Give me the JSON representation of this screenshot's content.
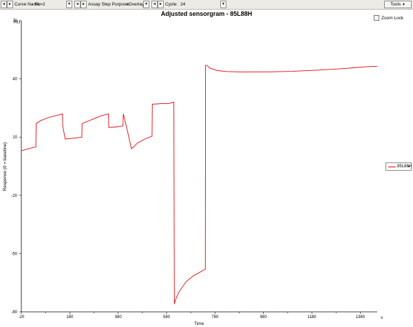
{
  "toolbar": {
    "curve_name_label": "Curve Name:",
    "curve_name_value": "Fc=2",
    "assay_step_label": "Assay Step Purpose:",
    "assay_step_value": "<Overlay>",
    "cycle_label": "Cycle:",
    "cycle_value": "24",
    "tools_label": "Tools"
  },
  "zoom_lock_label": "Zoom Lock",
  "legend_arrow": "▸",
  "colors": {
    "series": "#e0000b",
    "toolbar": "#ecebe6"
  },
  "chart_data": {
    "type": "line",
    "title": "Adjusted sensorgram - 85L88H",
    "xlabel": "Time",
    "ylabel": "Response (0 = baseline)",
    "y_unit": "RU",
    "x_unit": "s",
    "xlim": [
      -20,
      1450
    ],
    "ylim": [
      -80,
      70
    ],
    "x_ticks": [
      -20,
      180,
      380,
      580,
      780,
      980,
      1180,
      1380
    ],
    "y_ticks": [
      -80,
      -50,
      -20,
      10,
      40,
      70
    ],
    "legend_position": "right",
    "series": [
      {
        "name": "85L88H",
        "color": "#e0000b",
        "x": [
          -20,
          10,
          40,
          41,
          60,
          90,
          120,
          150,
          151,
          161,
          200,
          230,
          231,
          251,
          280,
          310,
          340,
          341,
          370,
          400,
          401,
          415,
          435,
          460,
          490,
          520,
          521,
          540,
          560,
          561,
          590,
          610,
          612,
          616,
          630,
          660,
          690,
          740,
          741,
          746,
          760,
          790,
          830,
          900,
          1000,
          1100,
          1200,
          1300,
          1400,
          1450
        ],
        "y": [
          3.0,
          4.0,
          5.0,
          17.0,
          18.5,
          20.0,
          21.0,
          22.0,
          16.0,
          9.0,
          9.5,
          10.0,
          17.0,
          18.0,
          19.5,
          21.0,
          22.0,
          15.0,
          15.2,
          15.8,
          22.0,
          15.0,
          4.0,
          7.0,
          9.0,
          10.5,
          27.0,
          27.1,
          27.3,
          27.3,
          27.3,
          28.0,
          -76.0,
          -74.0,
          -70.0,
          -64.5,
          -61.5,
          -58.0,
          47.0,
          47.0,
          45.5,
          44.3,
          43.8,
          43.5,
          43.6,
          43.9,
          44.5,
          45.2,
          46.2,
          46.5
        ]
      }
    ]
  }
}
